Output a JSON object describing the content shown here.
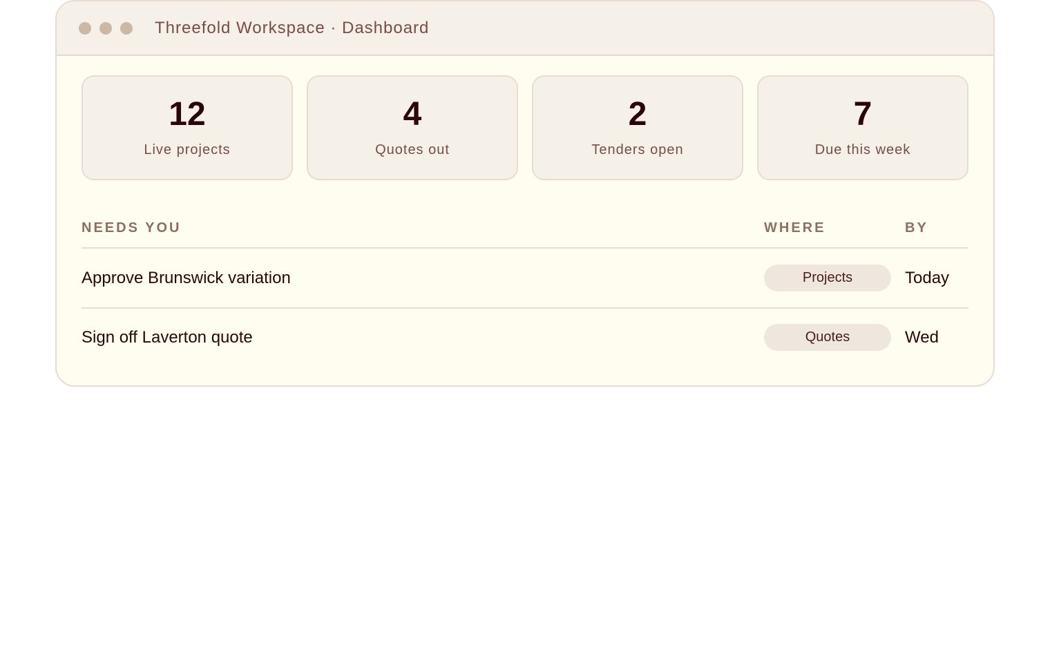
{
  "window": {
    "title": "Threefold Workspace · Dashboard"
  },
  "stats": [
    {
      "value": "12",
      "label": "Live projects"
    },
    {
      "value": "4",
      "label": "Quotes out"
    },
    {
      "value": "2",
      "label": "Tenders open"
    },
    {
      "value": "7",
      "label": "Due this week"
    }
  ],
  "table": {
    "headers": {
      "task": "NEEDS YOU",
      "where": "WHERE",
      "by": "BY"
    },
    "rows": [
      {
        "task": "Approve Brunswick variation",
        "where": "Projects",
        "by": "Today"
      },
      {
        "task": "Sign off Laverton quote",
        "where": "Quotes",
        "by": "Wed"
      }
    ]
  }
}
